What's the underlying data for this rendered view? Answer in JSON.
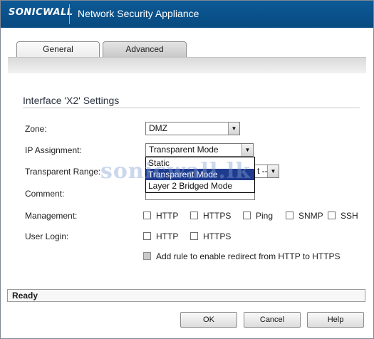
{
  "header": {
    "brand": "SONICWALL",
    "title": "Network Security Appliance"
  },
  "tabs": [
    {
      "label": "General",
      "active": true
    },
    {
      "label": "Advanced",
      "active": false
    }
  ],
  "section": {
    "title": "Interface 'X2' Settings"
  },
  "form": {
    "zone": {
      "label": "Zone:",
      "value": "DMZ"
    },
    "ip_assignment": {
      "label": "IP Assignment:",
      "value": "Transparent Mode",
      "options": [
        "Static",
        "Transparent Mode",
        "Layer 2 Bridged Mode"
      ],
      "highlighted": "Transparent Mode"
    },
    "transparent_range": {
      "label": "Transparent Range:",
      "value_fragment": "t --"
    },
    "comment": {
      "label": "Comment:",
      "value": ""
    },
    "management": {
      "label": "Management:",
      "options": [
        "HTTP",
        "HTTPS",
        "Ping",
        "SNMP",
        "SSH"
      ]
    },
    "user_login": {
      "label": "User Login:",
      "options": [
        "HTTP",
        "HTTPS"
      ]
    },
    "redirect_rule": {
      "label": "Add rule to enable redirect from HTTP to HTTPS",
      "disabled": true
    }
  },
  "watermark": "sonicwall.lk",
  "status": {
    "text": "Ready"
  },
  "buttons": {
    "ok": "OK",
    "cancel": "Cancel",
    "help": "Help"
  },
  "colors": {
    "header_bg": "#0b5390",
    "selection_bg": "#1f3b8f"
  }
}
